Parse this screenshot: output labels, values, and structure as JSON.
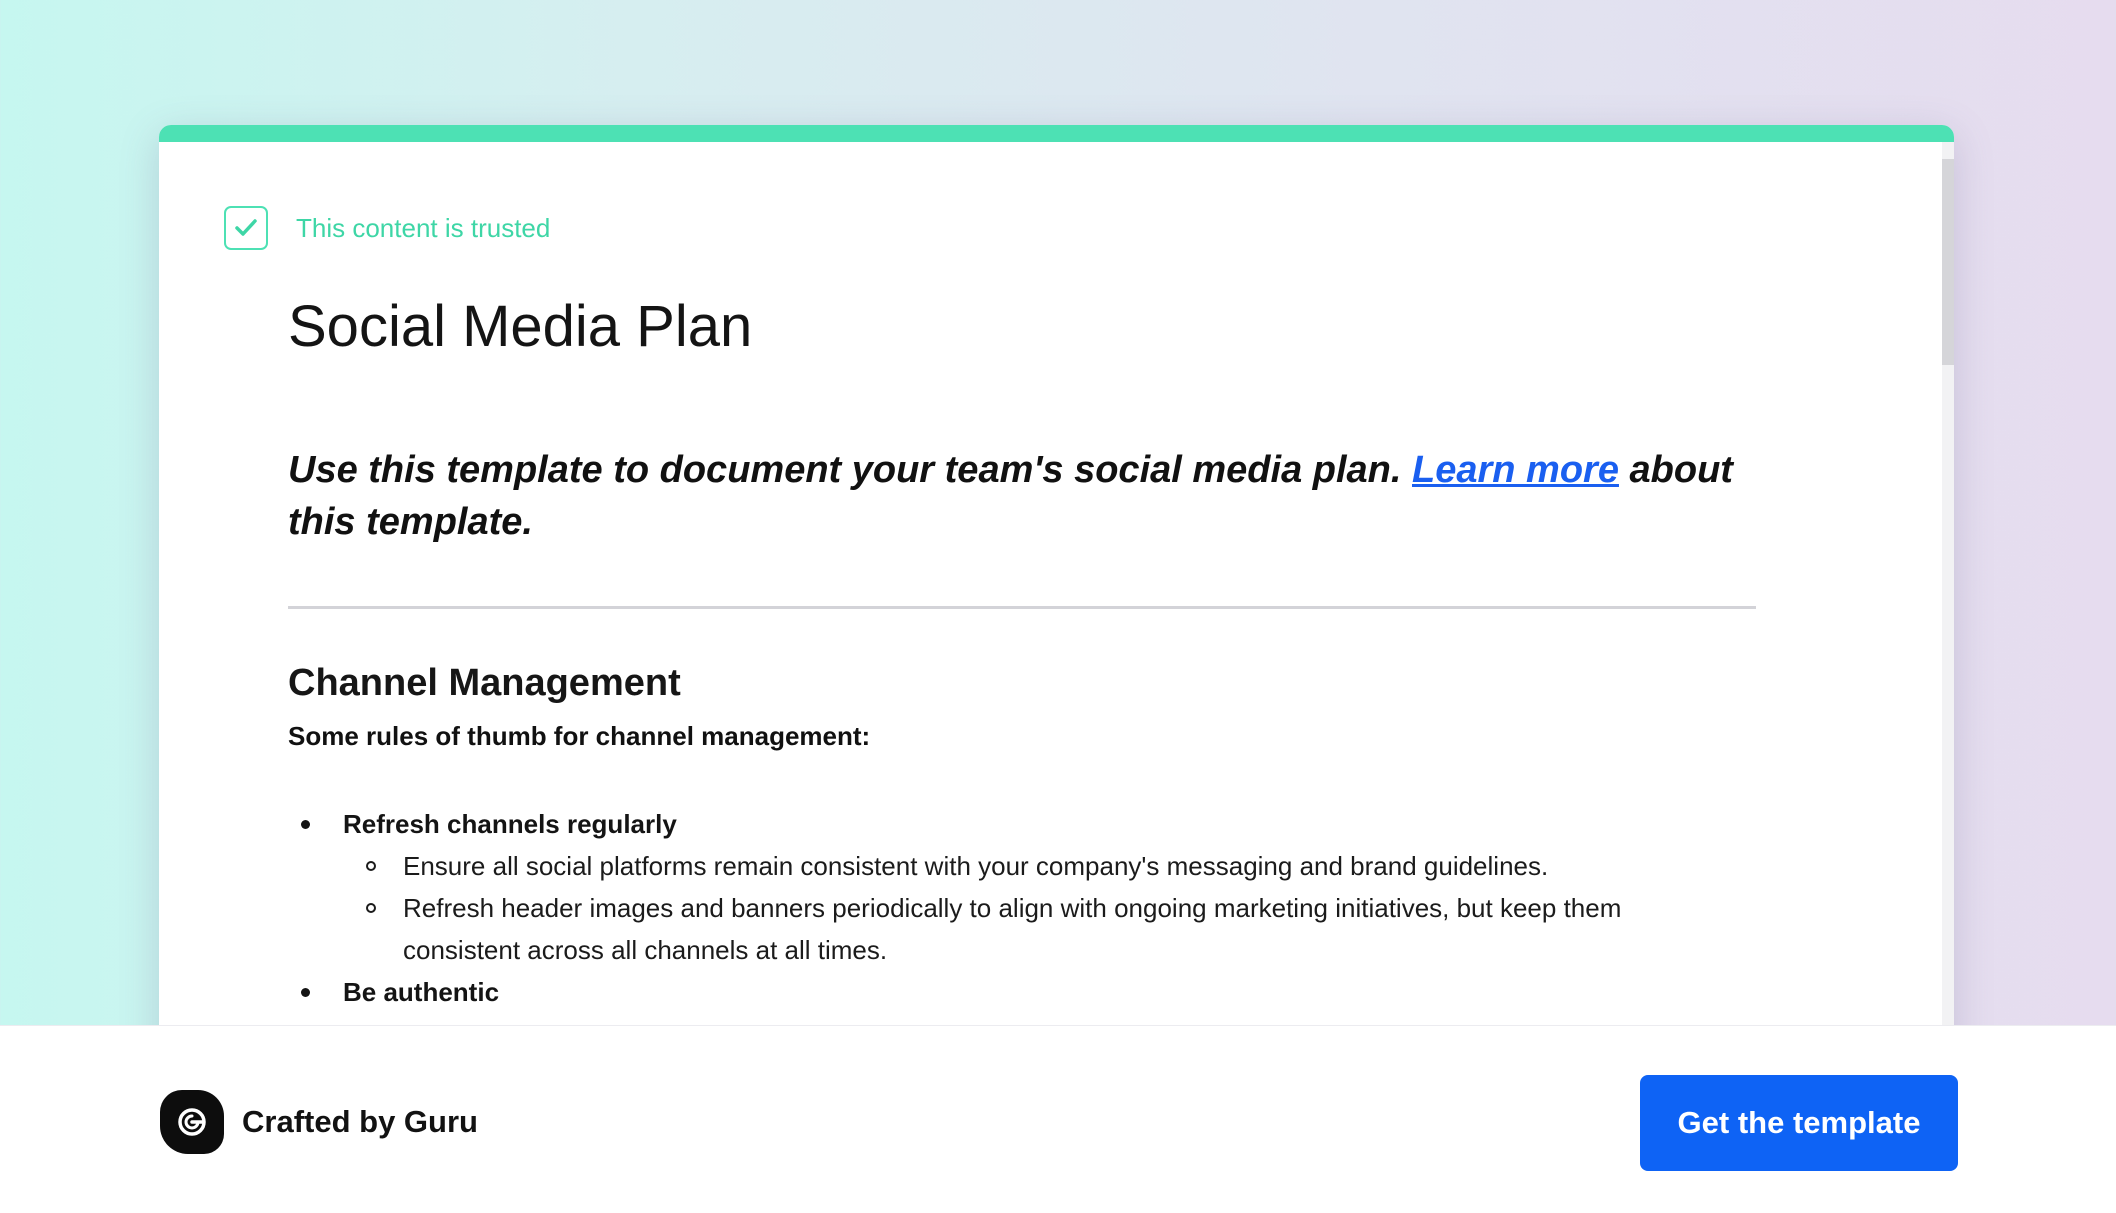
{
  "trust": {
    "label": "This content is trusted",
    "icon": "check-icon",
    "color": "#4de1b4"
  },
  "document": {
    "title": "Social Media Plan",
    "intro": {
      "before_link": "Use this template to document your team's social media plan. ",
      "link_text": "Learn more",
      "after_link": " about this template."
    },
    "section": {
      "heading": "Channel Management",
      "subheading": "Some rules of thumb for channel management:",
      "items": [
        {
          "label": "Refresh channels regularly",
          "subitems": [
            "Ensure all social platforms remain consistent with your company's messaging and brand guidelines.",
            "Refresh header images and banners periodically to align with ongoing marketing initiatives, but keep them consistent across all channels at all times."
          ]
        },
        {
          "label": "Be authentic",
          "subitems": []
        }
      ]
    }
  },
  "footer": {
    "brand_text": "Crafted by Guru",
    "logo_icon": "guru-logo-icon",
    "cta_label": "Get the template",
    "cta_color": "#0e63f5"
  }
}
